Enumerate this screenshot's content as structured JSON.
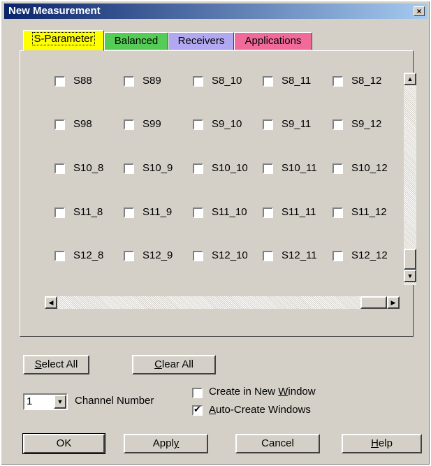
{
  "window": {
    "title": "New Measurement",
    "close_symbol": "×"
  },
  "tabs": [
    {
      "label": "S-Parameter",
      "color": "#ffff00",
      "active": true
    },
    {
      "label": "Balanced",
      "color": "#55cc55",
      "active": false
    },
    {
      "label": "Receivers",
      "color": "#b0a8f0",
      "active": false
    },
    {
      "label": "Applications",
      "color": "#f06a9a",
      "active": false
    }
  ],
  "grid": [
    [
      "S88",
      "S89",
      "S8_10",
      "S8_11",
      "S8_12"
    ],
    [
      "S98",
      "S99",
      "S9_10",
      "S9_11",
      "S9_12"
    ],
    [
      "S10_8",
      "S10_9",
      "S10_10",
      "S10_11",
      "S10_12"
    ],
    [
      "S11_8",
      "S11_9",
      "S11_10",
      "S11_11",
      "S11_12"
    ],
    [
      "S12_8",
      "S12_9",
      "S12_10",
      "S12_11",
      "S12_12"
    ]
  ],
  "scroll_arrows": {
    "up": "▲",
    "down": "▼",
    "left": "◀",
    "right": "▶"
  },
  "buttons": {
    "select_all": {
      "accel": "S",
      "rest": "elect All"
    },
    "clear_all": {
      "accel": "C",
      "rest": "lear All"
    },
    "ok": "OK",
    "apply": {
      "before": "Appl",
      "accel": "y"
    },
    "cancel": "Cancel",
    "help": {
      "accel": "H",
      "rest": "elp"
    }
  },
  "channel": {
    "value": "1",
    "label": "Channel Number",
    "arrow": "▼"
  },
  "options": {
    "create_new_window": {
      "before": "Create in New ",
      "accel": "W",
      "after": "indow",
      "checked": false
    },
    "auto_create": {
      "accel": "A",
      "rest": "uto-Create Windows",
      "checked": true
    }
  }
}
